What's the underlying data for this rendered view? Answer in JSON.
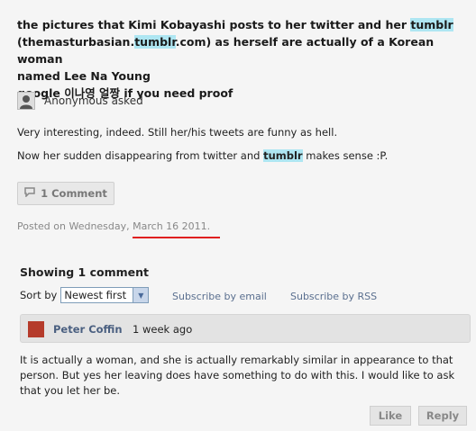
{
  "question": {
    "line1_a": "the pictures that Kimi Kobayashi posts to her twitter and her ",
    "line1_hl": "tumblr",
    "line2_a": "(themasturbasian.",
    "line2_hl": "tumblr",
    "line2_b": ".com) as herself are actually of a Korean woman",
    "line3": "named Lee Na Young",
    "line4_a": "google ",
    "line4_korean": "이나영 얼짱",
    "line4_b": " if you need proof"
  },
  "asker": {
    "name": "Anonymous asked",
    "avatar_icon": "silhouette-icon"
  },
  "answer": {
    "line1": "Very interesting, indeed. Still her/his tweets are funny as hell.",
    "line2_a": "Now her sudden disappearing from twitter and ",
    "line2_hl": "tumblr",
    "line2_b": " makes sense :P."
  },
  "comment_button": {
    "label": "1 Comment",
    "icon": "speech-bubble-icon"
  },
  "posted": {
    "prefix": "Posted on Wednesday, ",
    "date": "March 16 2011."
  },
  "comments": {
    "showing": "Showing 1 comment",
    "sort_label": "Sort by",
    "sort_value": "Newest first",
    "subscribe_email": "Subscribe by email",
    "subscribe_rss": "Subscribe by RSS"
  },
  "comment": {
    "author": "Peter Coffin",
    "time": "1 week ago",
    "text": "It is actually a woman, and she is actually remarkably similar in appearance to that person. But yes her leaving does have something to do with this. I would like to ask that you let her be.",
    "like_label": "Like",
    "reply_label": "Reply"
  },
  "colors": {
    "highlight": "#aee6f2",
    "underline": "#e02020",
    "link": "#5a6f8f",
    "author": "#4a5f80"
  }
}
